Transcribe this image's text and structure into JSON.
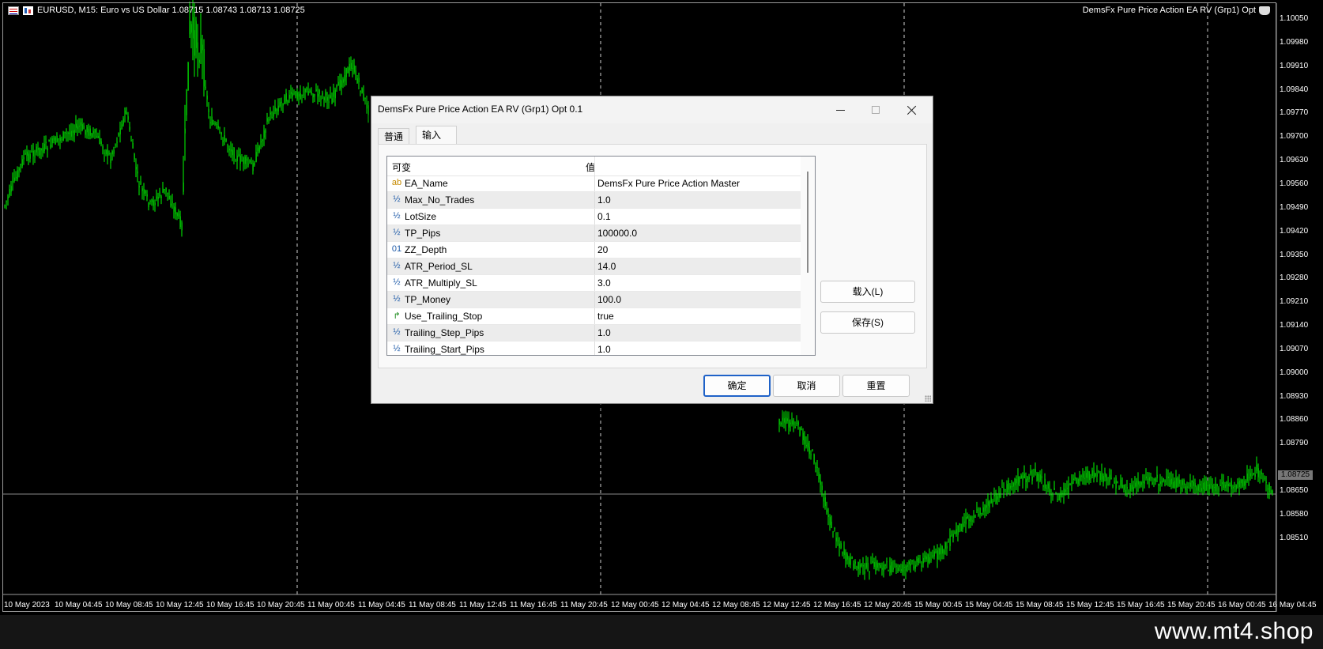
{
  "chart": {
    "title": "EURUSD, M15:  Euro vs US Dollar  1.08715 1.08743 1.08713 1.08725",
    "ea_label": "DemsFx  Pure Price Action EA RV  (Grp1) Opt",
    "current_price": "1.08725",
    "price_axis": [
      "1.10050",
      "1.09980",
      "1.09910",
      "1.09840",
      "1.09770",
      "1.09700",
      "1.09630",
      "1.09560",
      "1.09490",
      "1.09420",
      "1.09350",
      "1.09280",
      "1.09210",
      "1.09140",
      "1.09070",
      "1.09000",
      "1.08930",
      "1.08860",
      "1.08790",
      "1.08650",
      "1.08580",
      "1.08510"
    ],
    "time_axis": [
      "10 May 2023",
      "10 May 04:45",
      "10 May 08:45",
      "10 May 12:45",
      "10 May 16:45",
      "10 May 20:45",
      "11 May 00:45",
      "11 May 04:45",
      "11 May 08:45",
      "11 May 12:45",
      "11 May 16:45",
      "11 May 20:45",
      "12 May 00:45",
      "12 May 04:45",
      "12 May 08:45",
      "12 May 12:45",
      "12 May 16:45",
      "12 May 20:45",
      "15 May 00:45",
      "15 May 04:45",
      "15 May 08:45",
      "15 May 12:45",
      "15 May 16:45",
      "15 May 20:45",
      "16 May 00:45",
      "16 May 04:45"
    ],
    "candle_color": "#00ff00",
    "background": "#000000"
  },
  "dialog": {
    "title": "DemsFx  Pure Price Action EA RV  (Grp1) Opt 0.1",
    "tabs": [
      {
        "label": "普通",
        "active": false
      },
      {
        "label": "输入",
        "active": true
      }
    ],
    "grid": {
      "headers": {
        "variable": "可变",
        "value": "值"
      },
      "rows": [
        {
          "icon": "ab",
          "icon_name": "string-type-icon",
          "name": "EA_Name",
          "value": "DemsFx Pure Price Action Master"
        },
        {
          "icon": "½",
          "icon_name": "double-type-icon",
          "name": "Max_No_Trades",
          "value": "1.0"
        },
        {
          "icon": "½",
          "icon_name": "double-type-icon",
          "name": "LotSize",
          "value": "0.1"
        },
        {
          "icon": "½",
          "icon_name": "double-type-icon",
          "name": "TP_Pips",
          "value": "100000.0"
        },
        {
          "icon": "01",
          "icon_name": "integer-type-icon",
          "name": "ZZ_Depth",
          "value": "20"
        },
        {
          "icon": "½",
          "icon_name": "double-type-icon",
          "name": "ATR_Period_SL",
          "value": "14.0"
        },
        {
          "icon": "½",
          "icon_name": "double-type-icon",
          "name": "ATR_Multiply_SL",
          "value": "3.0"
        },
        {
          "icon": "½",
          "icon_name": "double-type-icon",
          "name": "TP_Money",
          "value": "100.0"
        },
        {
          "icon": "↱",
          "icon_name": "bool-type-icon",
          "name": "Use_Trailing_Stop",
          "value": "true"
        },
        {
          "icon": "½",
          "icon_name": "double-type-icon",
          "name": "Trailing_Step_Pips",
          "value": "1.0"
        },
        {
          "icon": "½",
          "icon_name": "double-type-icon",
          "name": "Trailing_Start_Pips",
          "value": "1.0"
        }
      ]
    },
    "buttons": {
      "load": "载入(L)",
      "save": "保存(S)",
      "ok": "确定",
      "cancel": "取消",
      "reset": "重置"
    }
  },
  "watermark": "www.mt4.shop"
}
